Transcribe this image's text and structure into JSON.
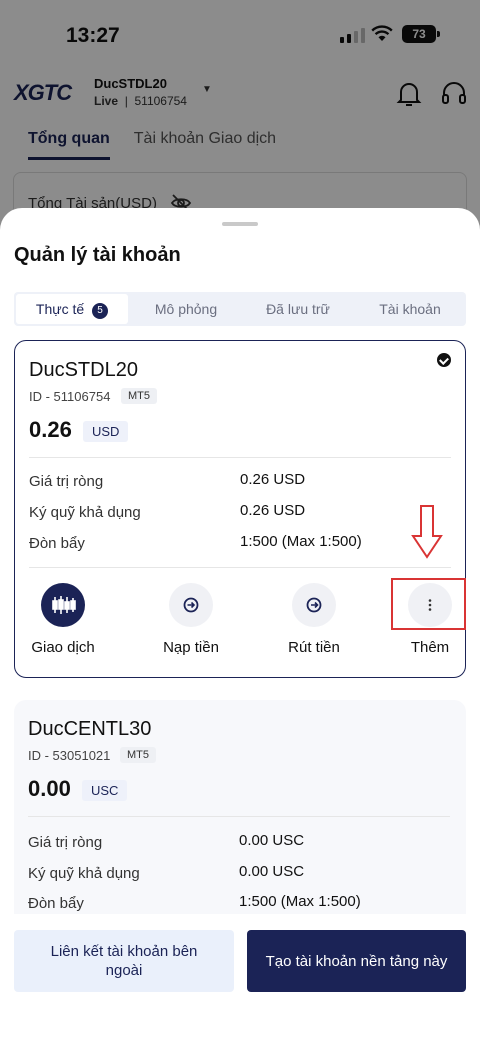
{
  "status_bar": {
    "time": "13:27",
    "battery": "73"
  },
  "app_header": {
    "logo": "XGTC",
    "account_name": "DucSTDL20",
    "account_type": "Live",
    "account_number": "51106754"
  },
  "bg_tabs": [
    "Tổng quan",
    "Tài khoản Giao dịch"
  ],
  "assets_label": "Tổng Tài sản(USD)",
  "sheet": {
    "title": "Quản lý tài khoản",
    "segments": [
      {
        "label": "Thực tế",
        "badge": "5"
      },
      {
        "label": "Mô phỏng"
      },
      {
        "label": "Đã lưu trữ"
      },
      {
        "label": "Tài khoản"
      }
    ]
  },
  "accounts": [
    {
      "name": "DucSTDL20",
      "id": "ID - 51106754",
      "platform": "MT5",
      "balance": "0.26",
      "currency": "USD",
      "rows": [
        {
          "label": "Giá trị ròng",
          "value": "0.26 USD"
        },
        {
          "label": "Ký quỹ khả dụng",
          "value": "0.26 USD"
        },
        {
          "label": "Đòn bẩy",
          "value": "1:500 (Max 1:500)"
        }
      ],
      "actions": [
        "Giao dịch",
        "Nạp tiền",
        "Rút tiền",
        "Thêm"
      ]
    },
    {
      "name": "DucCENTL30",
      "id": "ID - 53051021",
      "platform": "MT5",
      "balance": "0.00",
      "currency": "USC",
      "rows": [
        {
          "label": "Giá trị ròng",
          "value": "0.00 USC"
        },
        {
          "label": "Ký quỹ khả dụng",
          "value": "0.00 USC"
        },
        {
          "label": "Đòn bẩy",
          "value": "1:500 (Max 1:500)"
        }
      ]
    }
  ],
  "footer": {
    "link_button": "Liên kết tài khoản bên ngoài",
    "create_button": "Tạo tài khoản nền tảng này"
  },
  "colors": {
    "primary": "#1b2356",
    "annotation": "#d93434"
  }
}
